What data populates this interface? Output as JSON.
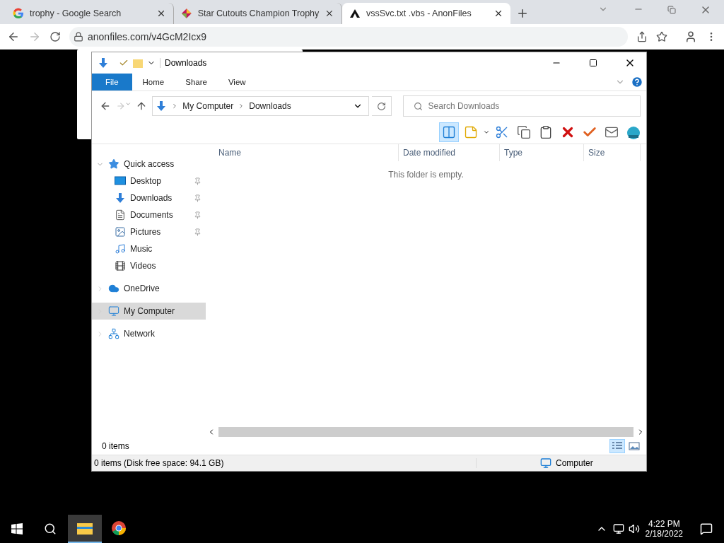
{
  "browser": {
    "tabs": [
      {
        "kind": "google",
        "title": "trophy - Google Search",
        "selected": false
      },
      {
        "kind": "star",
        "title": "Star Cutouts Champion Trophy",
        "selected": false
      },
      {
        "kind": "anon",
        "title": "vssSvc.txt .vbs - AnonFiles",
        "selected": true
      }
    ],
    "address": "anonfiles.com/v4GcM2Icx9"
  },
  "explorer": {
    "title": "Downloads",
    "ribbon_tabs": [
      {
        "kind": "file",
        "label": "File"
      },
      {
        "kind": "tab",
        "label": "Home"
      },
      {
        "kind": "tab",
        "label": "Share"
      },
      {
        "kind": "tab",
        "label": "View"
      }
    ],
    "nav_buttons": [
      {
        "kind": "back",
        "disabled": false
      },
      {
        "kind": "forward",
        "disabled": true
      },
      {
        "kind": "up",
        "disabled": false
      }
    ],
    "breadcrumb": [
      "My Computer",
      "Downloads"
    ],
    "search": {
      "placeholder": "Search Downloads"
    },
    "toolbar": [
      {
        "kind": "pane",
        "selected": true
      },
      {
        "kind": "note",
        "selected": false
      },
      {
        "kind": "cut",
        "selected": false
      },
      {
        "kind": "copy",
        "selected": false
      },
      {
        "kind": "paste",
        "selected": false
      },
      {
        "kind": "delete",
        "selected": false
      },
      {
        "kind": "check",
        "selected": false
      },
      {
        "kind": "mail",
        "selected": false
      },
      {
        "kind": "shell",
        "selected": false
      }
    ],
    "sidebar": [
      {
        "kind": "star",
        "label": "Quick access",
        "expanded": true,
        "selected": false,
        "children": [
          {
            "kind": "desktop",
            "label": "Desktop",
            "pinned": true
          },
          {
            "kind": "download",
            "label": "Downloads",
            "pinned": true
          },
          {
            "kind": "document",
            "label": "Documents",
            "pinned": true
          },
          {
            "kind": "picture",
            "label": "Pictures",
            "pinned": true
          },
          {
            "kind": "music",
            "label": "Music",
            "pinned": false
          },
          {
            "kind": "video",
            "label": "Videos",
            "pinned": false
          }
        ]
      },
      {
        "kind": "cloud",
        "label": "OneDrive",
        "expanded": false,
        "selected": false
      },
      {
        "kind": "computer",
        "label": "My Computer",
        "expanded": false,
        "selected": true
      },
      {
        "kind": "network",
        "label": "Network",
        "expanded": false,
        "selected": false
      }
    ],
    "columns": [
      "Name",
      "Date modified",
      "Type",
      "Size"
    ],
    "empty_message": "This folder is empty.",
    "item_count": "0 items",
    "view_buttons": [
      {
        "kind": "details",
        "selected": true
      },
      {
        "kind": "large",
        "selected": false
      }
    ],
    "status_bar": {
      "left": "0 items (Disk free space: 94.1 GB)",
      "right": "Computer"
    }
  },
  "taskbar": {
    "apps": [
      {
        "kind": "explorer",
        "selected": true
      },
      {
        "kind": "chrome",
        "selected": false
      }
    ],
    "time": "4:22 PM",
    "date": "2/18/2022"
  }
}
